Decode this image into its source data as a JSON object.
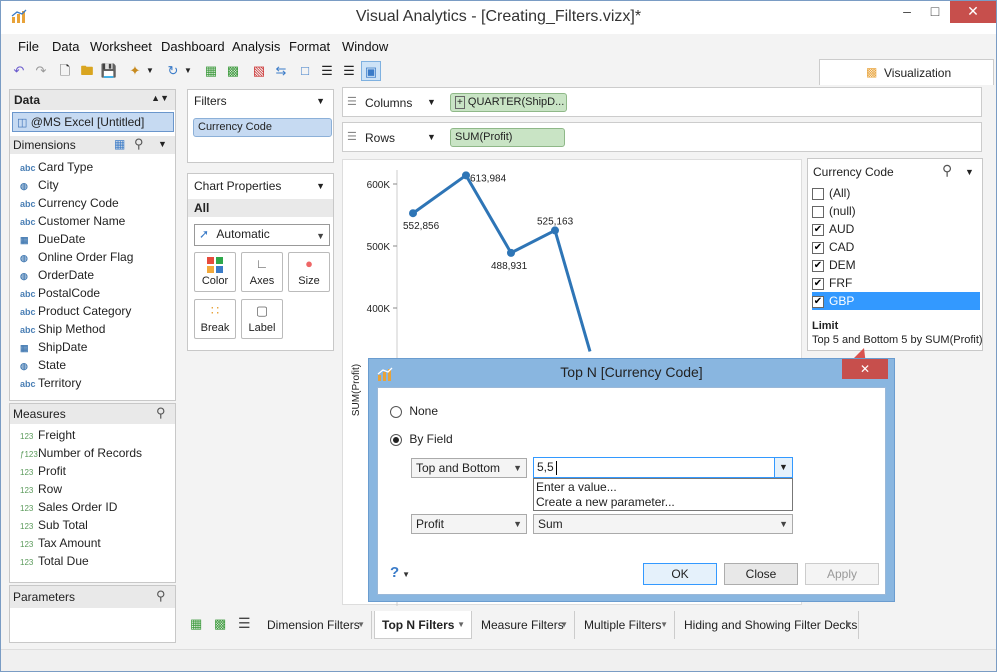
{
  "window": {
    "title": "Visual Analytics - [Creating_Filters.vizx]*",
    "minimize": "–",
    "maximize": "□",
    "close": "✕"
  },
  "menu": [
    "File",
    "Data",
    "Worksheet",
    "Dashboard",
    "Analysis",
    "Format",
    "Window"
  ],
  "visualization_tab": "Visualization",
  "data_panel": {
    "title": "Data",
    "source": "@MS Excel [Untitled]",
    "dimensions_title": "Dimensions",
    "dimensions": [
      {
        "type": "abc",
        "label": "Card Type"
      },
      {
        "type": "geo",
        "label": "City"
      },
      {
        "type": "abc",
        "label": "Currency Code"
      },
      {
        "type": "abc",
        "label": "Customer Name"
      },
      {
        "type": "date",
        "label": "DueDate"
      },
      {
        "type": "geo",
        "label": "Online Order Flag"
      },
      {
        "type": "geo",
        "label": "OrderDate"
      },
      {
        "type": "abc",
        "label": "PostalCode"
      },
      {
        "type": "abc",
        "label": "Product Category"
      },
      {
        "type": "abc",
        "label": "Ship Method"
      },
      {
        "type": "date",
        "label": "ShipDate"
      },
      {
        "type": "geo",
        "label": "State"
      },
      {
        "type": "abc",
        "label": "Territory"
      }
    ],
    "measures_title": "Measures",
    "measures": [
      {
        "type": "123",
        "label": "Freight"
      },
      {
        "type": "f123",
        "label": "Number of Records"
      },
      {
        "type": "123",
        "label": "Profit"
      },
      {
        "type": "123",
        "label": "Row"
      },
      {
        "type": "123",
        "label": "Sales Order ID"
      },
      {
        "type": "123",
        "label": "Sub Total"
      },
      {
        "type": "123",
        "label": "Tax Amount"
      },
      {
        "type": "123",
        "label": "Total Due"
      }
    ],
    "parameters_title": "Parameters"
  },
  "filters_panel": {
    "title": "Filters",
    "items": [
      "Currency Code"
    ]
  },
  "chart_properties": {
    "title": "Chart Properties",
    "scope": "All",
    "mark_type": "Automatic",
    "buttons": [
      "Color",
      "Axes",
      "Size",
      "Break",
      "Label"
    ]
  },
  "shelves": {
    "columns_label": "Columns",
    "columns_pill": "QUARTER(ShipD...",
    "rows_label": "Rows",
    "rows_pill": "SUM(Profit)"
  },
  "chart_data": {
    "type": "line",
    "ylabel": "SUM(Profit)",
    "yticks": [
      "600K",
      "500K",
      "400K"
    ],
    "ylim": [
      330000,
      630000
    ],
    "points": [
      {
        "x": 0,
        "y": 552856,
        "label": "552,856"
      },
      {
        "x": 1,
        "y": 613984,
        "label": "613,984"
      },
      {
        "x": 2,
        "y": 488931,
        "label": "488,931"
      },
      {
        "x": 3,
        "y": 525163,
        "label": "525,163"
      },
      {
        "x": 3.8,
        "y": 330000,
        "label": ""
      }
    ],
    "color": "#2e75b6"
  },
  "filter_card": {
    "title": "Currency Code",
    "options": [
      {
        "label": "(All)",
        "checked": false,
        "selected": false
      },
      {
        "label": "(null)",
        "checked": false,
        "selected": false
      },
      {
        "label": "AUD",
        "checked": true,
        "selected": false
      },
      {
        "label": "CAD",
        "checked": true,
        "selected": false
      },
      {
        "label": "DEM",
        "checked": true,
        "selected": false
      },
      {
        "label": "FRF",
        "checked": true,
        "selected": false
      },
      {
        "label": "GBP",
        "checked": true,
        "selected": true
      }
    ],
    "limit_title": "Limit",
    "limit_text": "Top 5 and Bottom 5 by SUM(Profit)"
  },
  "dialog": {
    "title": "Top N [Currency Code]",
    "option_none": "None",
    "option_by_field": "By Field",
    "mode": "Top and Bottom",
    "value": "5,5",
    "dropdown_options": [
      "Enter a value...",
      "Create a new parameter..."
    ],
    "field": "Profit",
    "aggregation": "Sum",
    "help": "?",
    "ok": "OK",
    "close": "Close",
    "apply": "Apply"
  },
  "sheet_tabs": [
    {
      "label": "Dimension Filters",
      "active": false
    },
    {
      "label": "Top N Filters",
      "active": true
    },
    {
      "label": "Measure Filters",
      "active": false
    },
    {
      "label": "Multiple Filters",
      "active": false
    },
    {
      "label": "Hiding and Showing Filter Decks",
      "active": false
    }
  ],
  "colors": {
    "accent": "#3399ff",
    "line": "#2e75b6",
    "dialog_frame": "#89b6e0",
    "close_red": "#c74f4c",
    "arrow": "#d9534f"
  }
}
